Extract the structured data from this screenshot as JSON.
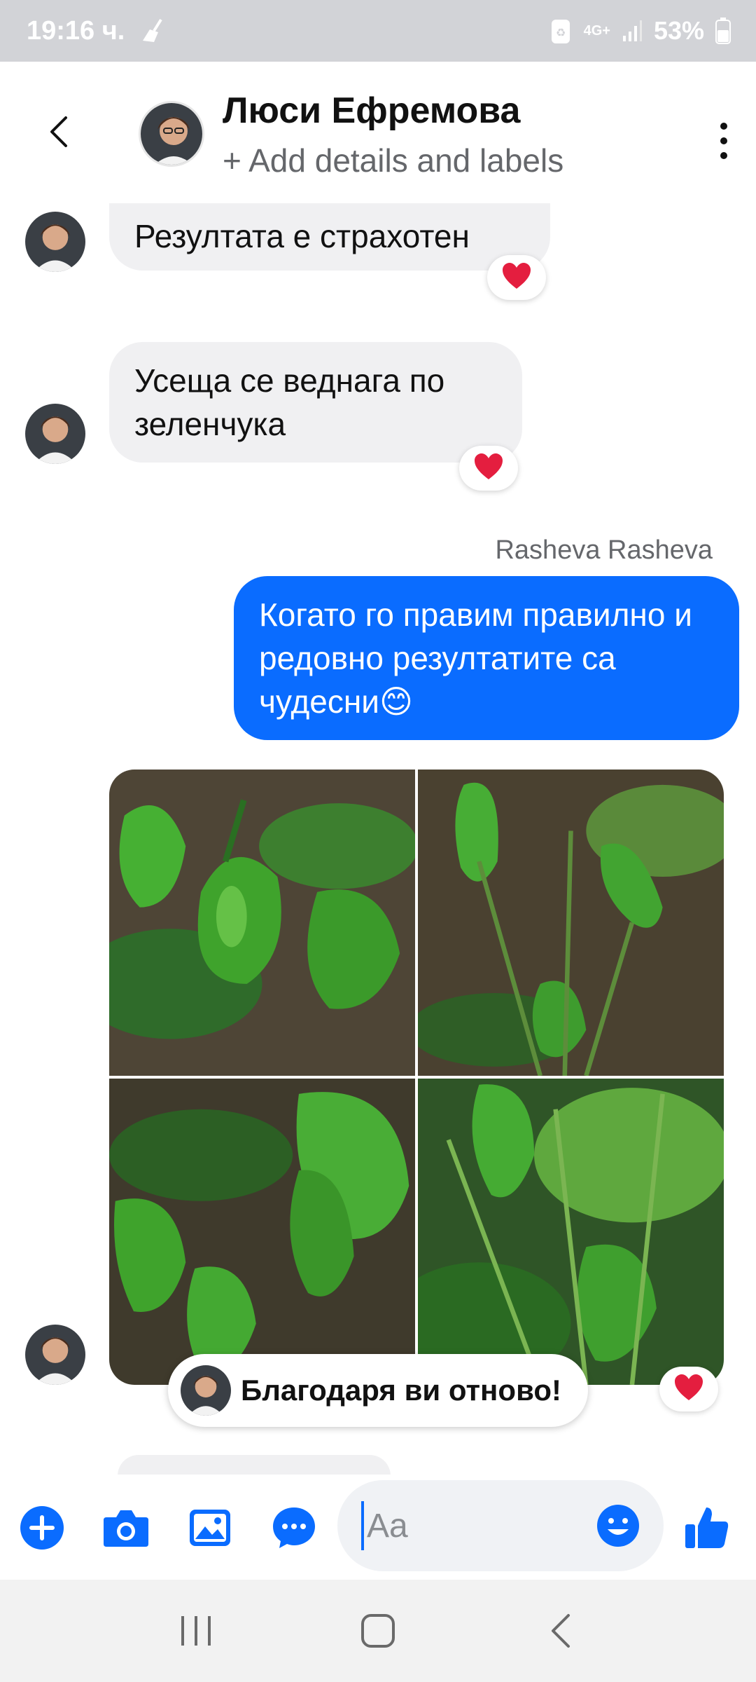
{
  "status_bar": {
    "time": "19:16 ч.",
    "battery": "53%",
    "network": "4G+",
    "icons": [
      "broom-icon",
      "battery-saver-icon",
      "signal-icon",
      "battery-icon"
    ]
  },
  "header": {
    "contact_name": "Люси Ефремова",
    "subtitle": "+ Add details and labels",
    "icons": [
      "back-arrow-icon",
      "more-vertical-icon"
    ]
  },
  "messages": [
    {
      "direction": "incoming",
      "text": "Резултата е страхотен",
      "reaction": "❤️"
    },
    {
      "direction": "incoming",
      "text": "Усеща се веднага по зеленчука",
      "reaction": "❤️"
    },
    {
      "direction": "outgoing",
      "sender": "Rasheva Rasheva",
      "text": "Когато го правим правилно и редовно резултатите са чудесни😊"
    },
    {
      "direction": "incoming",
      "type": "photos",
      "photo_count": 4,
      "reaction": "❤️"
    }
  ],
  "reply_preview": {
    "text": "Благодаря ви отново!"
  },
  "composer": {
    "placeholder": "Aa",
    "icons": [
      "plus-icon",
      "camera-icon",
      "gallery-icon",
      "chat-bubble-icon",
      "emoji-icon",
      "thumbs-up-icon"
    ]
  },
  "navbar": {
    "icons": [
      "recent-apps-icon",
      "home-icon",
      "back-icon"
    ]
  },
  "colors": {
    "accent": "#0a6cff",
    "incoming_bubble": "#f0f0f2",
    "reaction_heart": "#e41e3f",
    "status_bar": "#d2d3d7"
  }
}
